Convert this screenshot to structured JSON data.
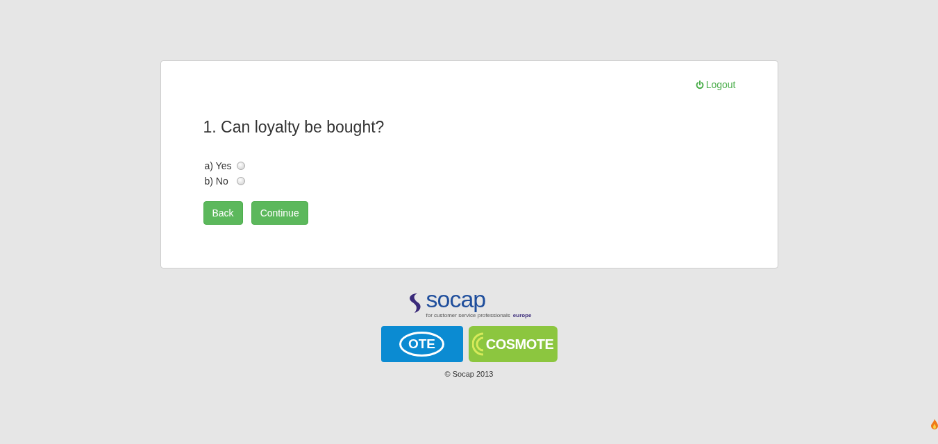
{
  "logout": {
    "label": "Logout"
  },
  "question": {
    "title": "1. Can loyalty be bought?",
    "options": [
      {
        "label": "a) Yes",
        "selected": false
      },
      {
        "label": "b) No",
        "selected": false
      }
    ]
  },
  "buttons": [
    "Back",
    "Continue"
  ],
  "footer": {
    "socap": {
      "name": "socap",
      "tagline": "for customer service professionals",
      "region": "europe"
    },
    "ote": "OTE",
    "cosmote": "COSMOTE",
    "copyright": "© Socap 2013"
  }
}
